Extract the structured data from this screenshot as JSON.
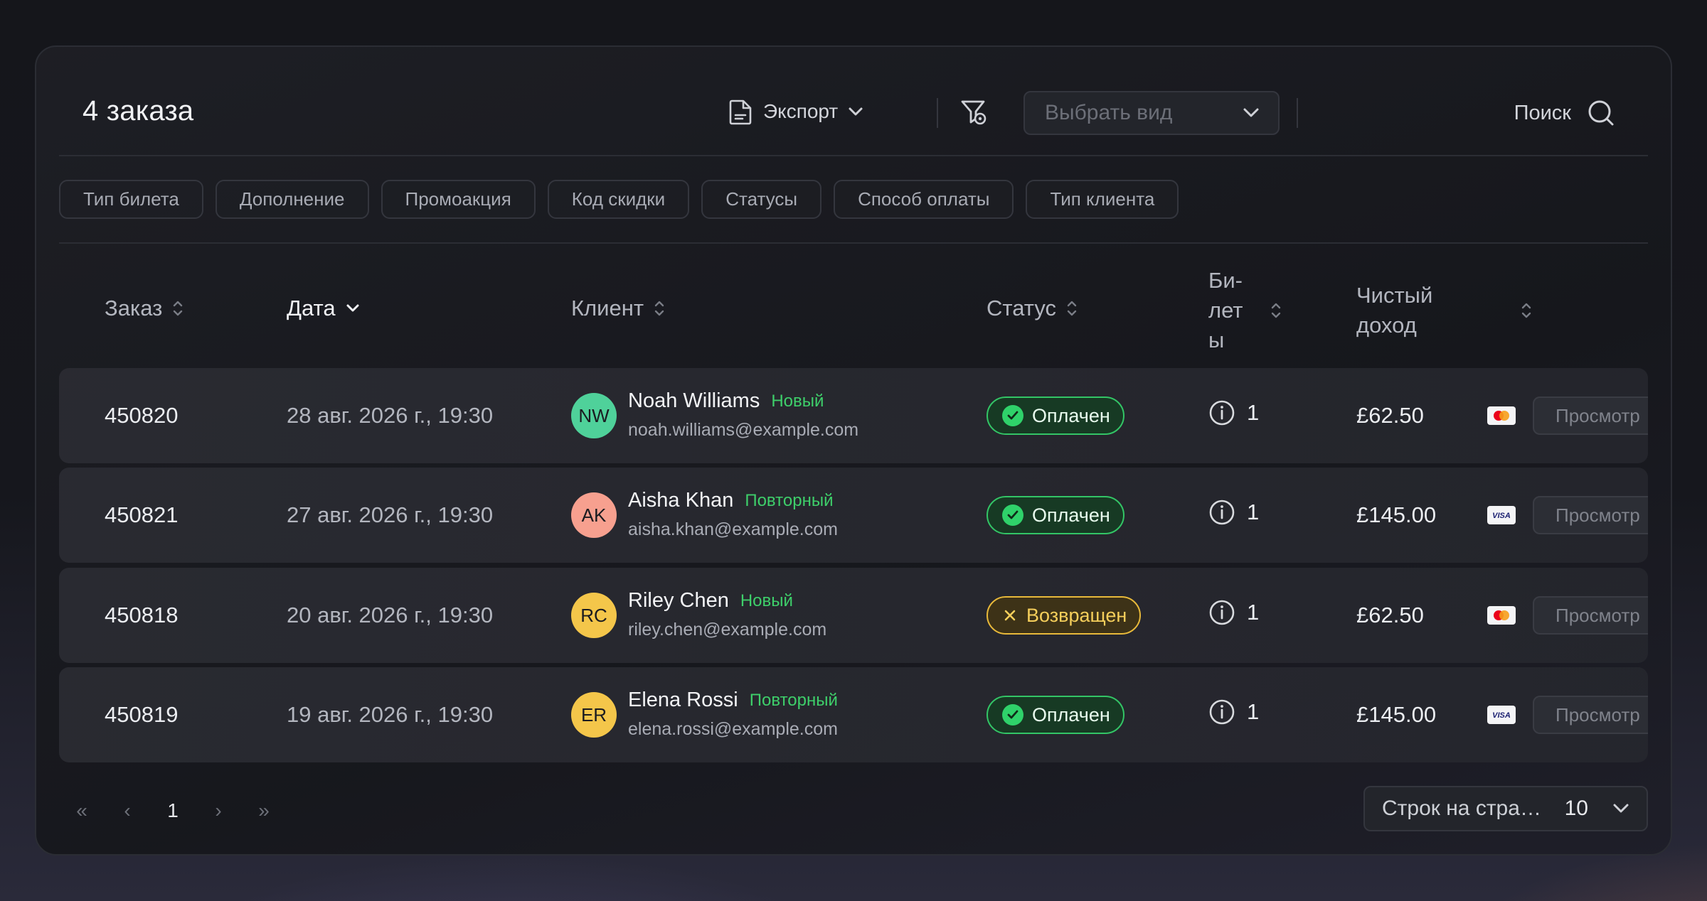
{
  "header": {
    "title": "4 заказа",
    "export_label": "Экспорт",
    "select_view_placeholder": "Выбрать вид",
    "search_label": "Поиск"
  },
  "filters": [
    "Тип билета",
    "Дополнение",
    "Промоакция",
    "Код скидки",
    "Статусы",
    "Способ оплаты",
    "Тип клиента"
  ],
  "columns": {
    "order": "Заказ",
    "date": "Дата",
    "customer": "Клиент",
    "status": "Статус",
    "tickets_l1": "Би-",
    "tickets_l2": "лет",
    "tickets_l3": "ы",
    "net_l1": "Чистый",
    "net_l2": "доход"
  },
  "orders": [
    {
      "id": "450820",
      "date": "28 авг. 2026 г., 19:30",
      "initials": "NW",
      "avatar_color": "#4fd19a",
      "name": "Noah Williams",
      "tag": "Новый",
      "email": "noah.williams@example.com",
      "status": "Оплачен",
      "status_kind": "paid",
      "tickets": "1",
      "net": "£62.50",
      "card": "mastercard",
      "view_label": "Просмотр"
    },
    {
      "id": "450821",
      "date": "27 авг. 2026 г., 19:30",
      "initials": "AK",
      "avatar_color": "#f7a08f",
      "name": "Aisha Khan",
      "tag": "Повторный",
      "email": "aisha.khan@example.com",
      "status": "Оплачен",
      "status_kind": "paid",
      "tickets": "1",
      "net": "£145.00",
      "card": "visa",
      "view_label": "Просмотр"
    },
    {
      "id": "450818",
      "date": "20 авг. 2026 г., 19:30",
      "initials": "RC",
      "avatar_color": "#f4c64a",
      "name": "Riley Chen",
      "tag": "Новый",
      "email": "riley.chen@example.com",
      "status": "Возвращен",
      "status_kind": "refunded",
      "tickets": "1",
      "net": "£62.50",
      "card": "mastercard",
      "view_label": "Просмотр"
    },
    {
      "id": "450819",
      "date": "19 авг. 2026 г., 19:30",
      "initials": "ER",
      "avatar_color": "#f4c64a",
      "name": "Elena Rossi",
      "tag": "Повторный",
      "email": "elena.rossi@example.com",
      "status": "Оплачен",
      "status_kind": "paid",
      "tickets": "1",
      "net": "£145.00",
      "card": "visa",
      "view_label": "Просмотр"
    }
  ],
  "pagination": {
    "first": "«",
    "prev": "‹",
    "current_page": "1",
    "next": "›",
    "last": "»",
    "rows_per_page_label": "Строк на странице",
    "rows_per_page_value": "10"
  }
}
